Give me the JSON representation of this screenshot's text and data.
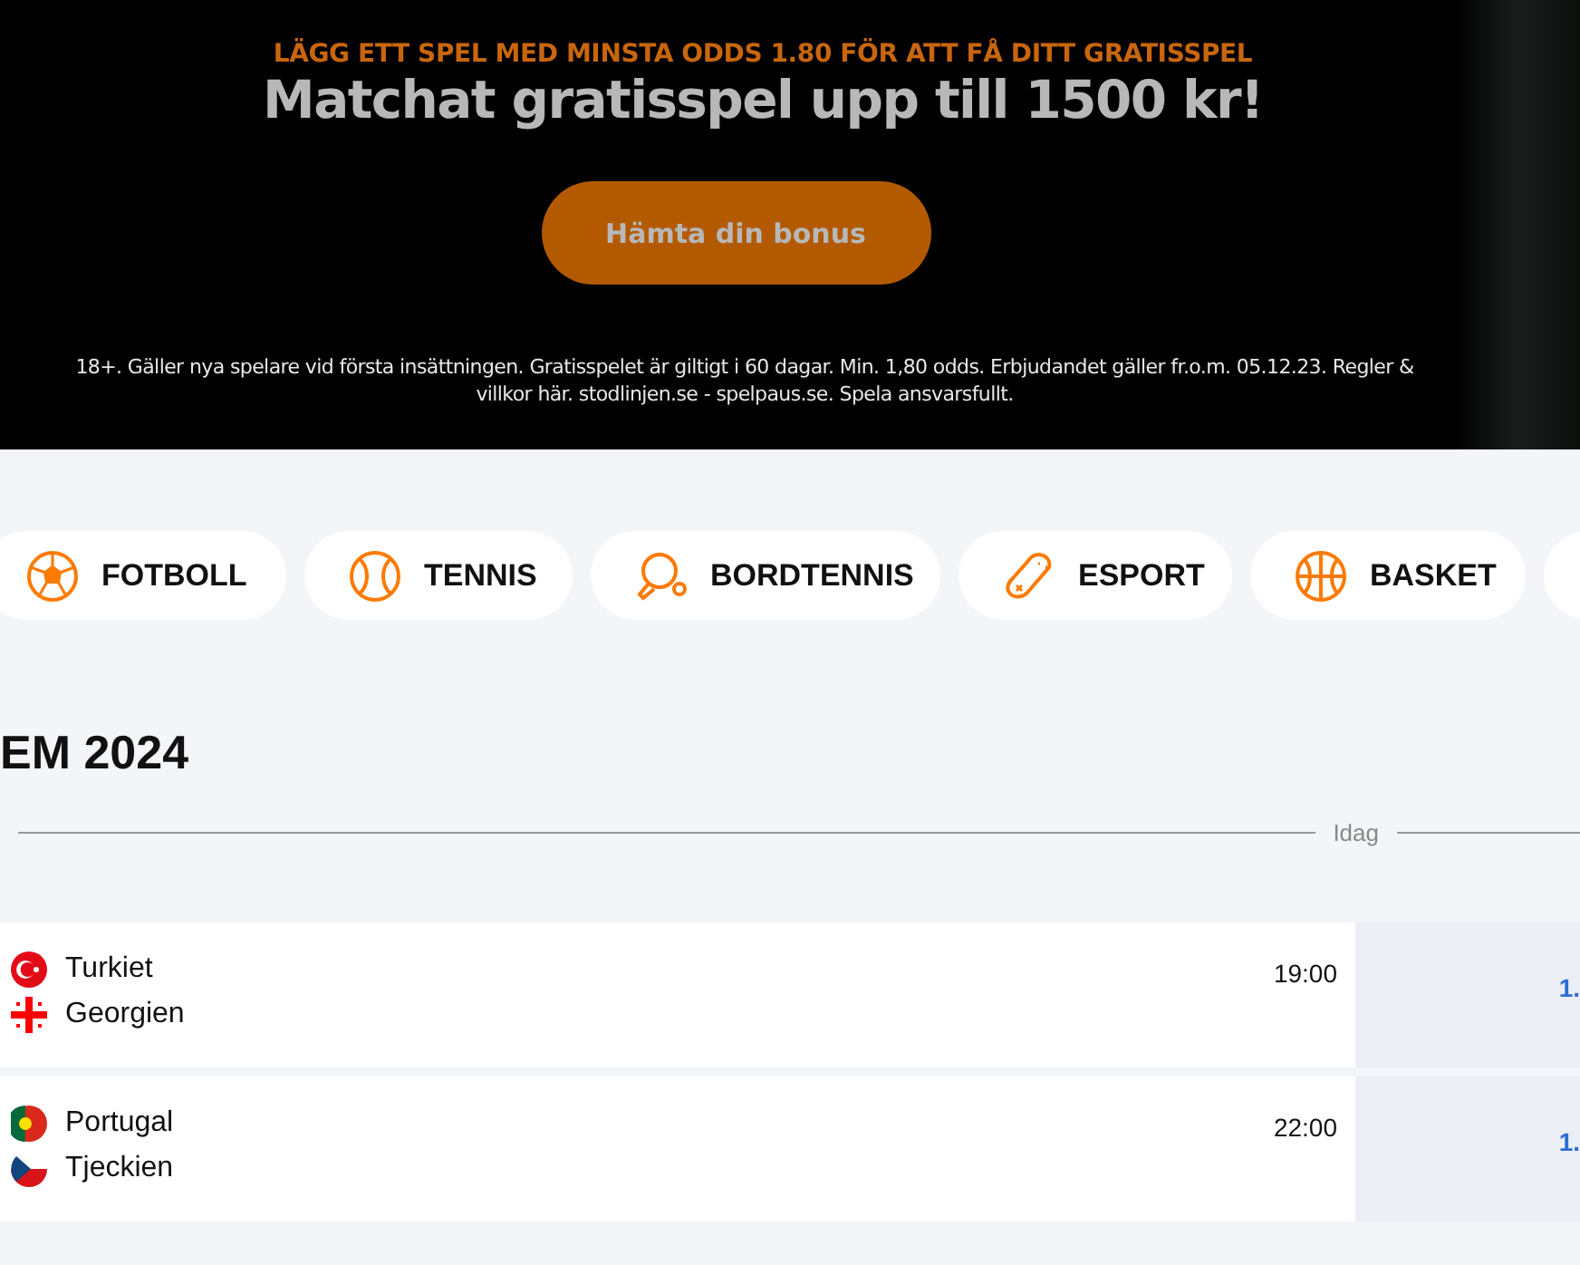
{
  "banner": {
    "kicker": "LÄGG ETT SPEL MED MINSTA ODDS 1.80 FÖR ATT FÅ DITT GRATISSPEL",
    "headline": "Matchat gratisspel upp till 1500 kr!",
    "button": "Hämta din bonus",
    "terms": "18+. Gäller nya spelare vid första insättningen. Gratisspelet är giltigt i 60 dagar. Min. 1,80 odds. Erbjudandet gäller fr.o.m. 05.12.23. Regler & villkor här. stodlinjen.se - spelpaus.se. Spela ansvarsfullt."
  },
  "sports": [
    {
      "label": "FOTBOLL",
      "kind": "football"
    },
    {
      "label": "TENNIS",
      "kind": "tennis"
    },
    {
      "label": "BORDTENNIS",
      "kind": "tabletennis"
    },
    {
      "label": "ESPORT",
      "kind": "esport"
    },
    {
      "label": "BASKET",
      "kind": "basket"
    }
  ],
  "section_title": "EM 2024",
  "day_label": "Idag",
  "matches": [
    {
      "time": "19:00",
      "odds": "1.",
      "teams": [
        {
          "name": "Turkiet",
          "kind": "turkey"
        },
        {
          "name": "Georgien",
          "kind": "georgia"
        }
      ]
    },
    {
      "time": "22:00",
      "odds": "1.",
      "teams": [
        {
          "name": "Portugal",
          "kind": "portugal"
        },
        {
          "name": "Tjeckien",
          "kind": "czech"
        }
      ]
    }
  ]
}
